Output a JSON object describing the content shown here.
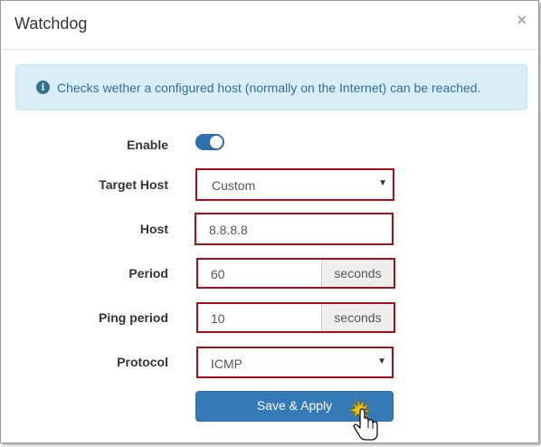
{
  "dialog": {
    "title": "Watchdog",
    "close_glyph": "×"
  },
  "alert": {
    "icon": "info-icon",
    "icon_glyph": "i",
    "text": "Checks wether a configured host (normally on the Internet) can be reached."
  },
  "form": {
    "enable": {
      "label": "Enable",
      "checked": true
    },
    "target_host": {
      "label": "Target Host",
      "value": "Custom"
    },
    "host": {
      "label": "Host",
      "value": "8.8.8.8"
    },
    "period": {
      "label": "Period",
      "value": "60",
      "unit": "seconds"
    },
    "ping_period": {
      "label": "Ping period",
      "value": "10",
      "unit": "seconds"
    },
    "protocol": {
      "label": "Protocol",
      "value": "ICMP"
    }
  },
  "actions": {
    "save_apply": "Save & Apply"
  },
  "colors": {
    "primary": "#337ab7",
    "alert_bg": "#d9edf7",
    "alert_text": "#31708f",
    "highlight_border": "#a50f17",
    "toggle_on": "#2f6fae"
  }
}
